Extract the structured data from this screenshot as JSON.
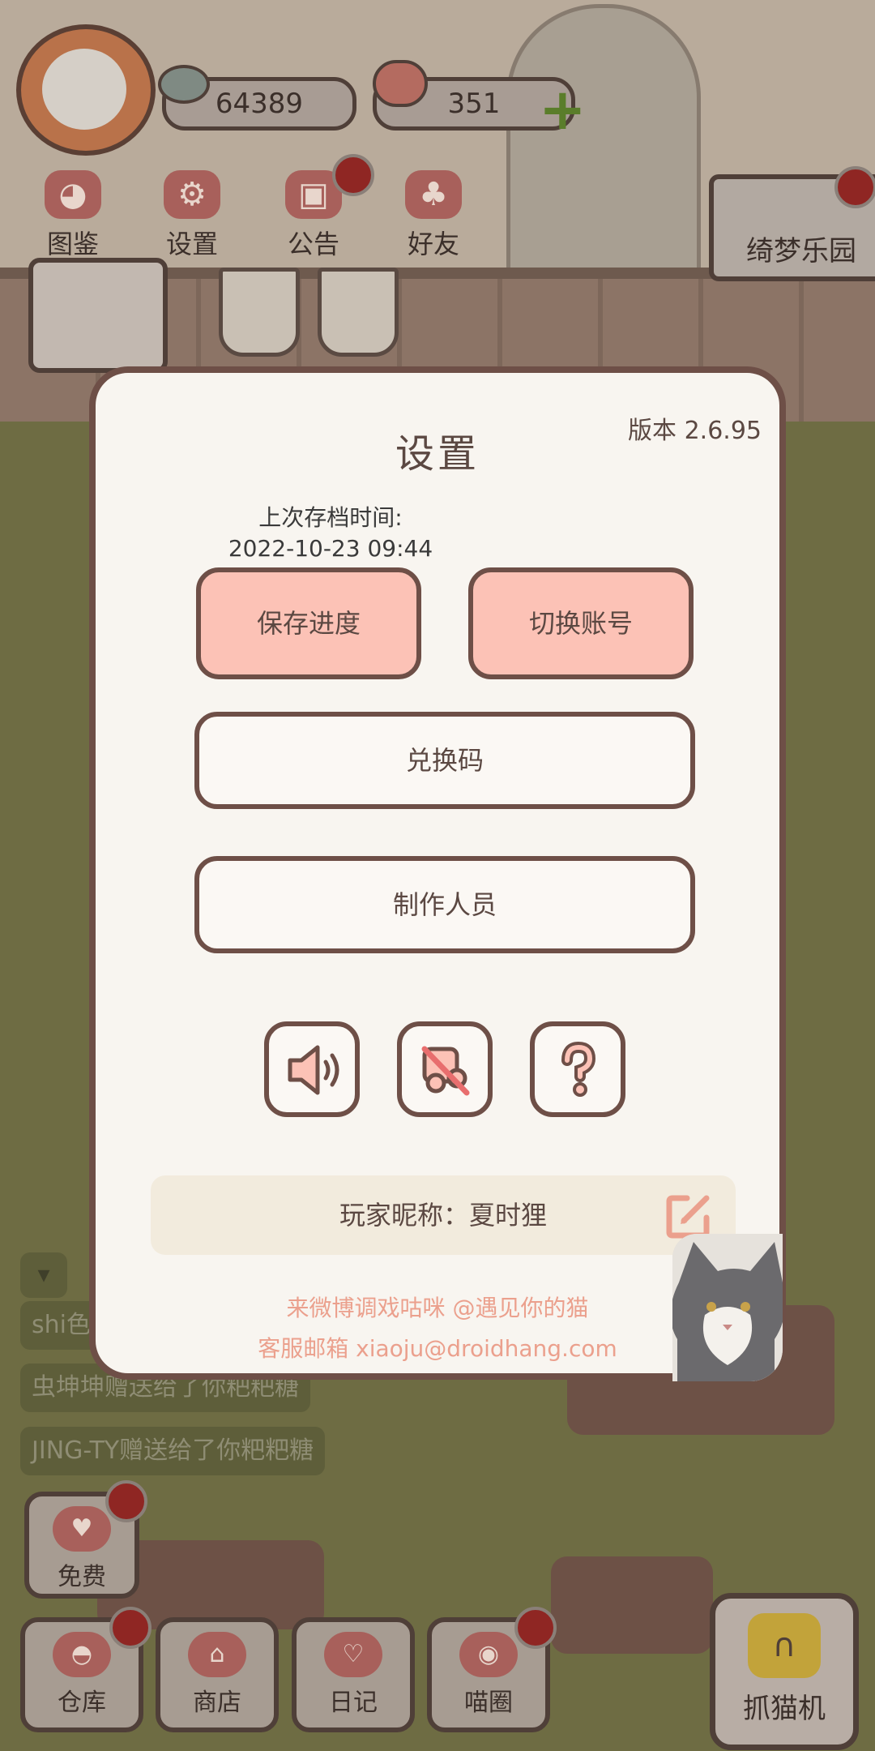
{
  "hud": {
    "coins": "64389",
    "hearts": "351"
  },
  "top_menu": {
    "collection": "图鉴",
    "settings": "设置",
    "notice": "公告",
    "friends": "好友"
  },
  "park_sign": "绮梦乐园",
  "chat": {
    "line1": "shi色",
    "line2": "虫坤坤赠送给了你粑粑糖",
    "line3": "JING-TY赠送给了你粑粑糖"
  },
  "bottom_nav": {
    "free": "免费",
    "storage": "仓库",
    "shop": "商店",
    "diary": "日记",
    "circle": "喵圈",
    "claw": "抓猫机"
  },
  "dialog": {
    "title": "设置",
    "version": "版本 2.6.95",
    "save_time_label": "上次存档时间:",
    "save_time_value": "2022-10-23 09:44",
    "save_button": "保存进度",
    "switch_account_button": "切换账号",
    "redeem_button": "兑换码",
    "credits_button": "制作人员",
    "nickname": "玩家昵称：夏时狸",
    "weibo_text": "来微博调戏咕咪 @遇见你的猫",
    "email_text": "客服邮箱 xiaoju@droidhang.com"
  },
  "colors": {
    "accent_pink": "#fcc2b6",
    "border_brown": "#6e4f47",
    "footer_text": "#eba08d",
    "dialog_bg": "#f8f5f0"
  },
  "icons": {
    "sound": "speaker-icon",
    "music": "music-muted-icon",
    "help": "question-icon",
    "edit": "edit-icon"
  }
}
